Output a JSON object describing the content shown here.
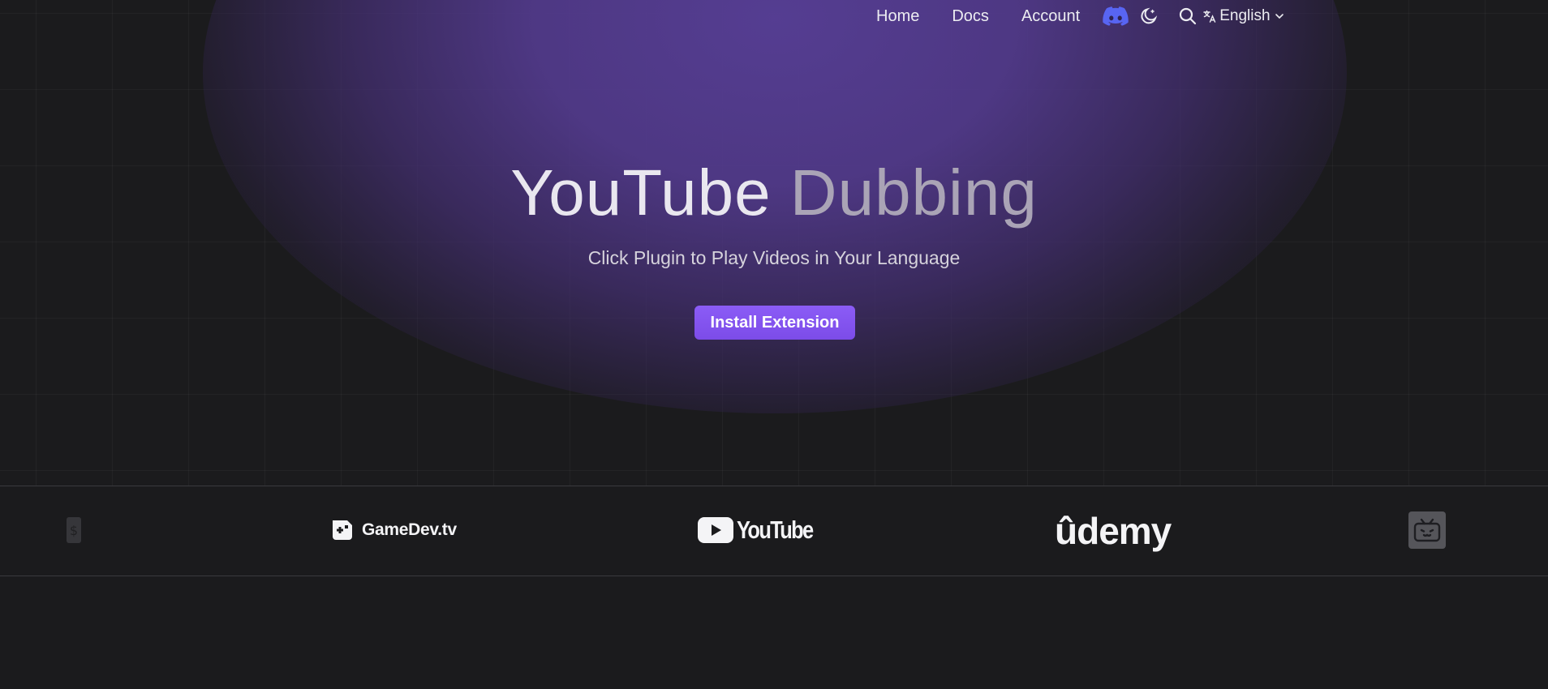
{
  "nav": {
    "home": "Home",
    "docs": "Docs",
    "account": "Account",
    "language": "English",
    "icons": [
      "discord-icon",
      "moon-icon",
      "search-icon",
      "translate-icon",
      "chevron-down-icon"
    ]
  },
  "hero": {
    "title_part1": "YouTube",
    "title_part2": "Dubbing",
    "subtitle": "Click Plugin to Play Videos in Your Language",
    "cta": "Install Extension"
  },
  "partners": {
    "gamedev": "GameDev.tv",
    "youtube": "YouTube",
    "udemy": "ûdemy"
  },
  "colors": {
    "background": "#1b1b1d",
    "glow": "#563e94",
    "accent": "#8b5cf6",
    "discord": "#5865f2"
  }
}
